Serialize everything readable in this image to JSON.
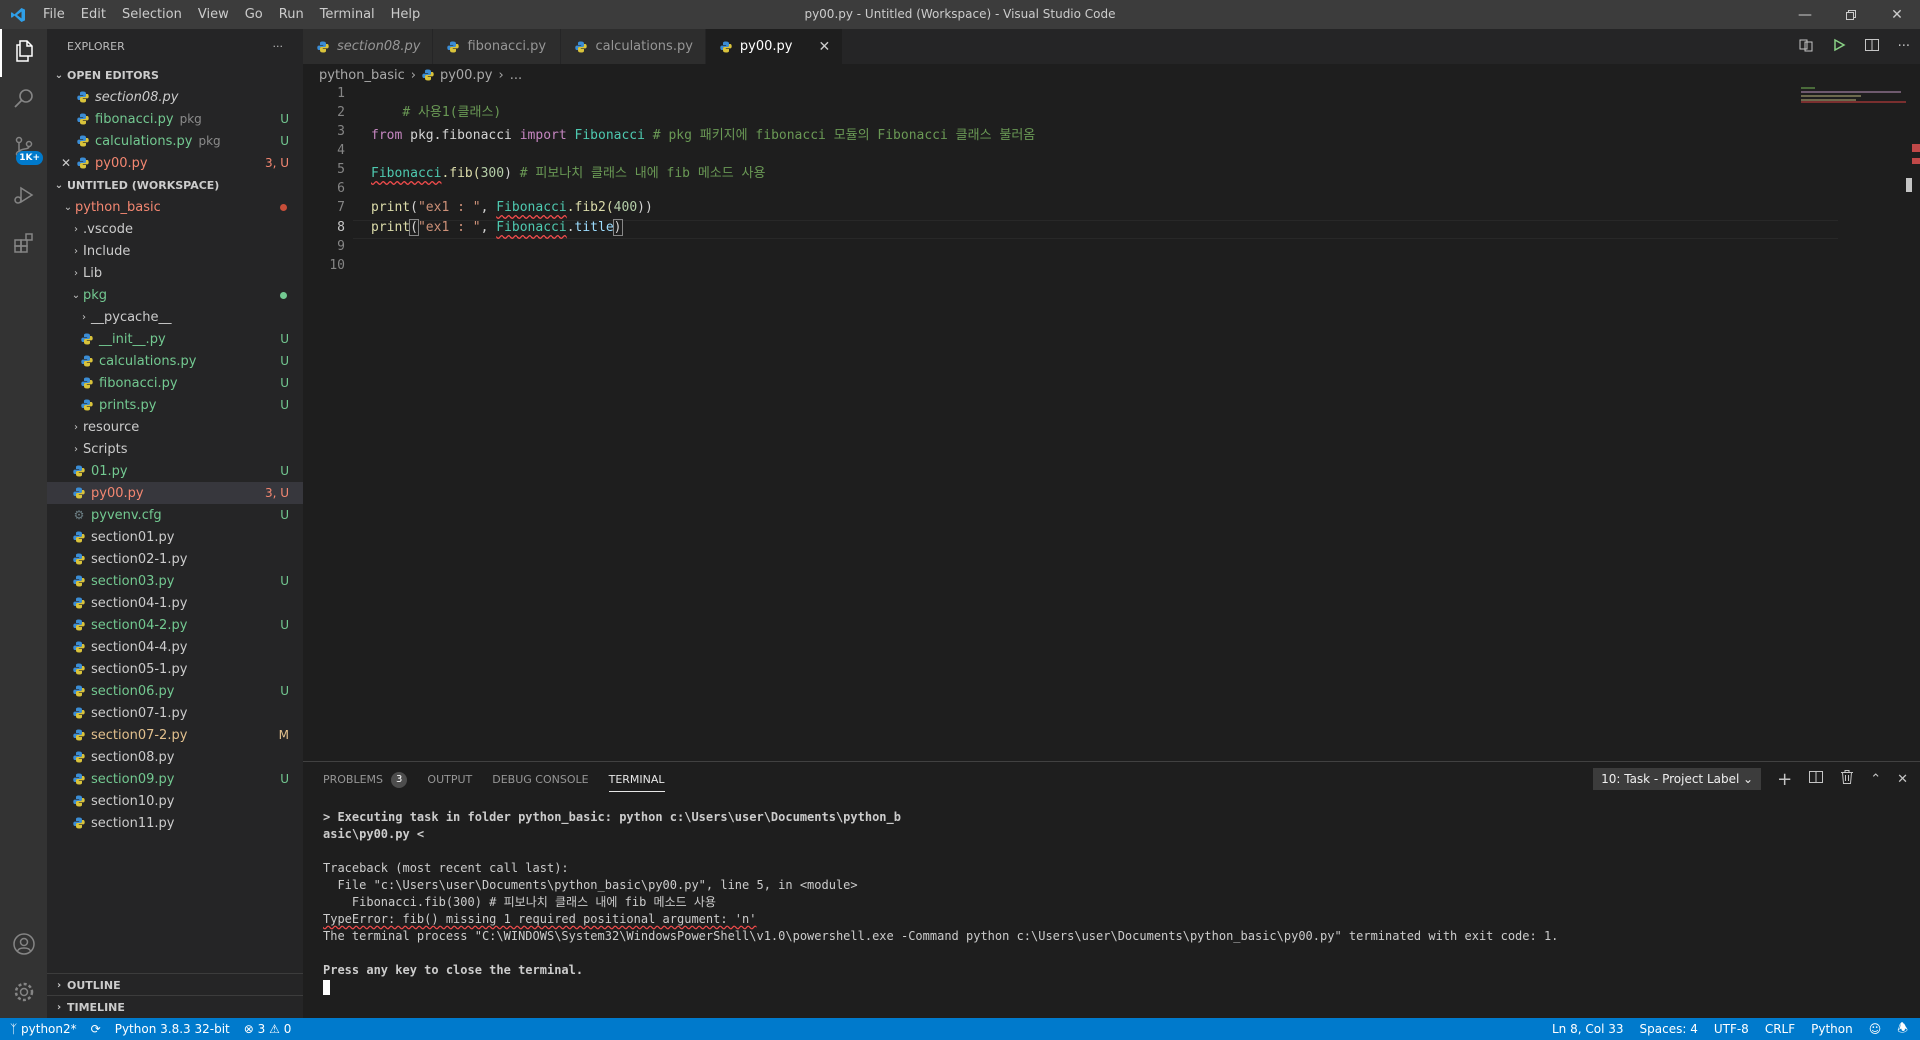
{
  "titlebar": {
    "menus": [
      "File",
      "Edit",
      "Selection",
      "View",
      "Go",
      "Run",
      "Terminal",
      "Help"
    ],
    "title": "py00.py - Untitled (Workspace) - Visual Studio Code"
  },
  "activity": {
    "scm_badge": "1K+"
  },
  "explorer": {
    "title": "EXPLORER",
    "open_editors_label": "OPEN EDITORS",
    "open_editors": [
      {
        "name": "section08.py",
        "desc": "",
        "status": ""
      },
      {
        "name": "fibonacci.py",
        "desc": "pkg",
        "status": "U"
      },
      {
        "name": "calculations.py",
        "desc": "pkg",
        "status": "U"
      },
      {
        "name": "py00.py",
        "desc": "",
        "status": "3, U"
      }
    ],
    "workspace_label": "UNTITLED (WORKSPACE)",
    "tree": [
      {
        "name": "python_basic",
        "status": ""
      },
      {
        "name": ".vscode",
        "status": ""
      },
      {
        "name": "Include",
        "status": ""
      },
      {
        "name": "Lib",
        "status": ""
      },
      {
        "name": "pkg",
        "status": ""
      },
      {
        "name": "__pycache__",
        "status": ""
      },
      {
        "name": "__init__.py",
        "status": "U"
      },
      {
        "name": "calculations.py",
        "status": "U"
      },
      {
        "name": "fibonacci.py",
        "status": "U"
      },
      {
        "name": "prints.py",
        "status": "U"
      },
      {
        "name": "resource",
        "status": ""
      },
      {
        "name": "Scripts",
        "status": ""
      },
      {
        "name": "01.py",
        "status": "U"
      },
      {
        "name": "py00.py",
        "status": "3, U"
      },
      {
        "name": "pyvenv.cfg",
        "status": "U"
      },
      {
        "name": "section01.py",
        "status": ""
      },
      {
        "name": "section02-1.py",
        "status": ""
      },
      {
        "name": "section03.py",
        "status": "U"
      },
      {
        "name": "section04-1.py",
        "status": ""
      },
      {
        "name": "section04-2.py",
        "status": "U"
      },
      {
        "name": "section04-4.py",
        "status": ""
      },
      {
        "name": "section05-1.py",
        "status": ""
      },
      {
        "name": "section06.py",
        "status": "U"
      },
      {
        "name": "section07-1.py",
        "status": ""
      },
      {
        "name": "section07-2.py",
        "status": "M"
      },
      {
        "name": "section08.py",
        "status": ""
      },
      {
        "name": "section09.py",
        "status": "U"
      },
      {
        "name": "section10.py",
        "status": ""
      },
      {
        "name": "section11.py",
        "status": ""
      }
    ],
    "outline_label": "OUTLINE",
    "timeline_label": "TIMELINE"
  },
  "tabs": [
    "section08.py",
    "fibonacci.py",
    "calculations.py",
    "py00.py"
  ],
  "breadcrumb": {
    "folder": "python_basic",
    "file": "py00.py",
    "more": "..."
  },
  "editor": {
    "line_numbers": [
      "1",
      "2",
      "3",
      "4",
      "5",
      "6",
      "7",
      "8",
      "9",
      "10"
    ],
    "line1": "# 사용1(클래스)",
    "line3": {
      "kw_from": "from",
      "mod": "pkg.fibonacci",
      "kw_import": "import",
      "cls": "Fibonacci",
      "comment": "# pkg 패키지에 fibonacci 모듈의 Fibonacci 클래스 불러옴"
    },
    "line5": {
      "cls": "Fibonacci",
      "rest": ".fib(",
      "num": "300",
      "close": ")",
      "comment": "# 피보나치 클래스 내에 fib 메소드 사용"
    },
    "line7": {
      "fn": "print",
      "open": "(",
      "str": "\"ex1 : \"",
      "comma": ", ",
      "cls": "Fibonacci",
      "rest": ".fib2(",
      "num": "400",
      "close": "))"
    },
    "line8": {
      "fn": "print",
      "open": "(",
      "str": "\"ex1 : \"",
      "comma": ", ",
      "cls": "Fibonacci",
      "dot": ".",
      "attr": "title",
      "close": ")"
    }
  },
  "panel": {
    "tabs": {
      "problems": "PROBLEMS",
      "problems_count": "3",
      "output": "OUTPUT",
      "debug": "DEBUG CONSOLE",
      "terminal": "TERMINAL"
    },
    "task_select": "10: Task - Project Label",
    "terminal_lines": [
      "> Executing task in folder python_basic: python c:\\Users\\user\\Documents\\python_b",
      "asic\\py00.py <",
      "",
      "Traceback (most recent call last):",
      "  File \"c:\\Users\\user\\Documents\\python_basic\\py00.py\", line 5, in <module>",
      "    Fibonacci.fib(300) # 피보나치 클래스 내에 fib 메소드 사용",
      "TypeError: fib() missing 1 required positional argument: 'n'",
      "The terminal process \"C:\\WINDOWS\\System32\\WindowsPowerShell\\v1.0\\powershell.exe -Command python c:\\Users\\user\\Documents\\python_basic\\py00.py\" terminated with exit code: 1.",
      "",
      "Press any key to close the terminal."
    ]
  },
  "statusbar": {
    "branch": "python2*",
    "interpreter": "Python 3.8.3 32-bit",
    "errors": "3",
    "warnings": "0",
    "position": "Ln 8, Col 33",
    "spaces": "Spaces: 4",
    "encoding": "UTF-8",
    "eol": "CRLF",
    "language": "Python"
  },
  "colors": {
    "accent": "#007acc",
    "untracked": "#73c991",
    "error": "#f48771",
    "modified": "#e2c08d"
  }
}
